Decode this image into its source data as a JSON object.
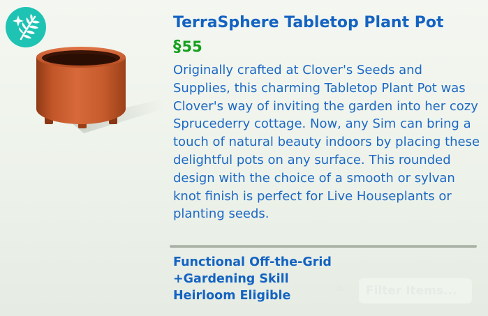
{
  "item": {
    "title": "TerraSphere Tabletop Plant Pot",
    "price": {
      "currency_icon": "simoleon-icon",
      "currency_symbol": "§",
      "value": "55"
    },
    "description": "Originally crafted at Clover's Seeds and Supplies, this charming Tabletop Plant Pot was Clover's way of inviting the garden into her cozy Sprucederry cottage. Now, any Sim can bring a touch of natural beauty indoors by placing these delightful pots on any surface. This rounded design with the choice of a smooth or sylvan knot finish is perfect for Live Houseplants or planting seeds.",
    "features": [
      "Functional Off-the-Grid",
      "+Gardening Skill",
      "Heirloom Eligible"
    ],
    "pack_icon": "sparkle-leaf-icon",
    "image": "terracotta-pot"
  },
  "filter": {
    "placeholder": "Filter Items...",
    "icon": "up-arrow-icon"
  },
  "colors": {
    "title": "#1463c2",
    "text": "#1d69c4",
    "price": "#14a01c",
    "badge": "#1fc3b3",
    "pot": "#c65b2c"
  }
}
